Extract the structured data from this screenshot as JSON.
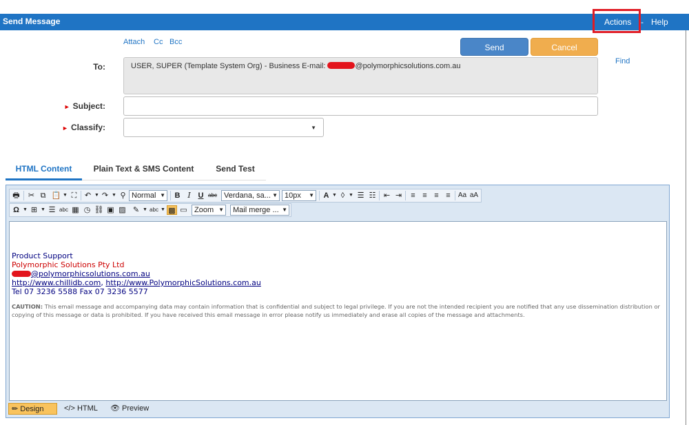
{
  "header": {
    "title": "Send Message",
    "menu": {
      "actions": "Actions",
      "separator": "-",
      "help": "Help"
    }
  },
  "recipient_links": {
    "attach": "Attach",
    "cc": "Cc",
    "bcc": "Bcc"
  },
  "buttons": {
    "send": "Send",
    "cancel": "Cancel",
    "find": "Find"
  },
  "form": {
    "to_label": "To:",
    "to_prefix": "USER, SUPER (Template System Org) - Business E-mail: ",
    "to_suffix": "@polymorphicsolutions.com.au",
    "subject_label": "Subject:",
    "subject_value": "",
    "classify_label": "Classify:",
    "classify_value": "",
    "required_marker": "►"
  },
  "tabs": [
    {
      "label": "HTML Content",
      "active": true
    },
    {
      "label": "Plain Text & SMS Content",
      "active": false
    },
    {
      "label": "Send Test",
      "active": false
    }
  ],
  "toolbar": {
    "format": "Normal",
    "font": "Verdana, sa...",
    "size": "10px",
    "zoom": "Zoom",
    "mail_merge": "Mail merge ..."
  },
  "signature": {
    "line1": "Product Support",
    "line2": "Polymorphic Solutions Pty Ltd",
    "email_suffix": "@polymorphicsolutions.com.au",
    "link1": "http://www.chillidb.com",
    "link_sep": ", ",
    "link2": "http://www.PolymorphicSolutions.com.au",
    "phone": "Tel 07 3236 5588  Fax 07 3236 5577",
    "caution_label": "CAUTION:",
    "caution_text": " This email message and accompanying data may contain information that is confidential and subject to legal privilege. If you are not the intended recipient you are notified that any use dissemination distribution or copying of this message or data is prohibited. If you have received this email message in error please notify us immediately and erase all copies of the message and attachments."
  },
  "editor_modes": {
    "design": "Design",
    "html": "HTML",
    "preview": "Preview"
  },
  "colors": {
    "accent": "#1f74c4",
    "send": "#4a86c8",
    "cancel": "#f0ad4e",
    "signature_red": "#cc0000",
    "signature_blue": "#000080",
    "highlight": "#e01b24"
  }
}
